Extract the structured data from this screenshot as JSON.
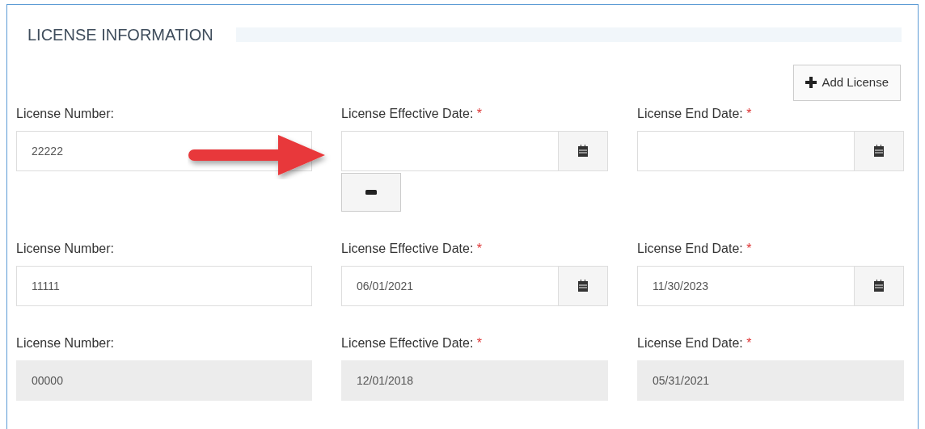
{
  "section": {
    "title": "LICENSE INFORMATION"
  },
  "add_button": {
    "label": "Add License"
  },
  "licenses": [
    {
      "disabled": false,
      "removable": true,
      "annotated": true,
      "fields": [
        {
          "label": "License Number:",
          "calendar": false,
          "value_text": "22222"
        },
        {
          "label": "License Effective Date:",
          "required_mark": "*",
          "calendar": true
        },
        {
          "label": "License End Date:",
          "required_mark": "*",
          "calendar": true
        }
      ]
    },
    {
      "disabled": false,
      "removable": false,
      "annotated": false,
      "fields": [
        {
          "label": "License Number:",
          "calendar": false,
          "value_text": "11111"
        },
        {
          "label": "License Effective Date:",
          "required_mark": "*",
          "calendar": true,
          "value_text": "06/01/2021"
        },
        {
          "label": "License End Date:",
          "required_mark": "*",
          "calendar": true,
          "value_text": "11/30/2023"
        }
      ]
    },
    {
      "disabled": true,
      "removable": false,
      "annotated": false,
      "fields": [
        {
          "label": "License Number:",
          "calendar": false,
          "value_text": "00000"
        },
        {
          "label": "License Effective Date:",
          "required_mark": "*",
          "calendar": false,
          "value_text": "12/01/2018"
        },
        {
          "label": "License End Date:",
          "required_mark": "*",
          "calendar": false,
          "value_text": "05/31/2021"
        }
      ]
    }
  ]
}
